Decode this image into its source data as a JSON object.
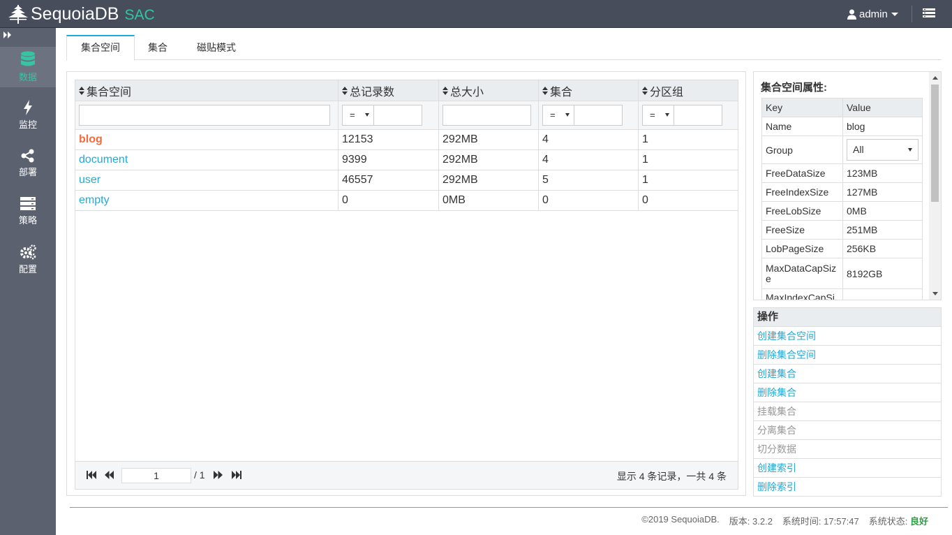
{
  "header": {
    "brand": "SequoiaDB",
    "product": "SAC",
    "user": "admin"
  },
  "sidebar": {
    "items": [
      {
        "label": "数据",
        "icon": "database-icon"
      },
      {
        "label": "监控",
        "icon": "lightning-icon"
      },
      {
        "label": "部署",
        "icon": "share-icon"
      },
      {
        "label": "策略",
        "icon": "server-icon"
      },
      {
        "label": "配置",
        "icon": "gears-icon"
      }
    ]
  },
  "tabs": [
    {
      "label": "集合空间"
    },
    {
      "label": "集合"
    },
    {
      "label": "磁贴模式"
    }
  ],
  "grid": {
    "columns": [
      {
        "label": "集合空间"
      },
      {
        "label": "总记录数"
      },
      {
        "label": "总大小"
      },
      {
        "label": "集合"
      },
      {
        "label": "分区组"
      }
    ],
    "filters": {
      "operator": "="
    },
    "rows": [
      {
        "name": "blog",
        "records": "12153",
        "size": "292MB",
        "collections": "4",
        "groups": "1"
      },
      {
        "name": "document",
        "records": "9399",
        "size": "292MB",
        "collections": "4",
        "groups": "1"
      },
      {
        "name": "user",
        "records": "46557",
        "size": "292MB",
        "collections": "5",
        "groups": "1"
      },
      {
        "name": "empty",
        "records": "0",
        "size": "0MB",
        "collections": "0",
        "groups": "0"
      }
    ],
    "pager": {
      "page": "1",
      "total_pages": "/ 1",
      "info": "显示 4 条记录，一共 4 条"
    }
  },
  "properties": {
    "title": "集合空间属性:",
    "key_header": "Key",
    "value_header": "Value",
    "rows": [
      {
        "key": "Name",
        "value": "blog"
      },
      {
        "key": "Group",
        "value": "All"
      },
      {
        "key": "FreeDataSize",
        "value": "123MB"
      },
      {
        "key": "FreeIndexSize",
        "value": "127MB"
      },
      {
        "key": "FreeLobSize",
        "value": "0MB"
      },
      {
        "key": "FreeSize",
        "value": "251MB"
      },
      {
        "key": "LobPageSize",
        "value": "256KB"
      },
      {
        "key": "MaxDataCapSize",
        "value": "8192GB"
      },
      {
        "key": "MaxIndexCapSi",
        "value": ""
      }
    ]
  },
  "operations": {
    "title": "操作",
    "items": [
      {
        "label": "创建集合空间",
        "enabled": true
      },
      {
        "label": "删除集合空间",
        "enabled": true
      },
      {
        "label": "创建集合",
        "enabled": true
      },
      {
        "label": "删除集合",
        "enabled": true
      },
      {
        "label": "挂载集合",
        "enabled": false
      },
      {
        "label": "分离集合",
        "enabled": false
      },
      {
        "label": "切分数据",
        "enabled": false
      },
      {
        "label": "创建索引",
        "enabled": true
      },
      {
        "label": "删除索引",
        "enabled": true
      }
    ]
  },
  "footer": {
    "copyright": "©2019 SequoiaDB.",
    "version": "版本: 3.2.2",
    "time": "系统时间: 17:57:47",
    "status_label": "系统状态: ",
    "status_value": "良好"
  },
  "colors": {
    "accent": "#35c5a2",
    "link": "#23a9d6",
    "selected": "#f26d3d"
  }
}
